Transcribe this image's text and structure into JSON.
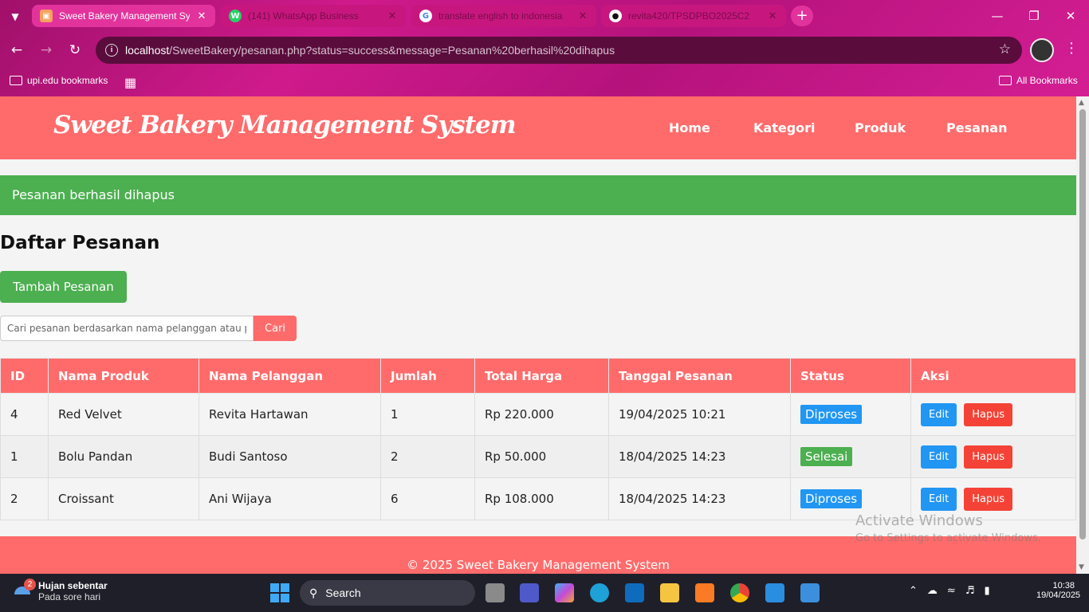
{
  "browser": {
    "tabs": [
      {
        "title": "Sweet Bakery Management Syst",
        "active": true
      },
      {
        "title": "(141) WhatsApp Business",
        "active": false
      },
      {
        "title": "translate english to indonesia",
        "active": false
      },
      {
        "title": "revita420/TPSDPBO2025C2",
        "active": false
      }
    ],
    "new_tab_label": "+",
    "url_host": "localhost",
    "url_path": "/SweetBakery/pesanan.php?status=success&message=Pesanan%20berhasil%20dihapus",
    "bookmarks": [
      {
        "label": "upi.edu bookmarks"
      },
      {
        "label": "All Bookmarks"
      }
    ]
  },
  "site": {
    "title": "Sweet Bakery Management System",
    "nav": [
      "Home",
      "Kategori",
      "Produk",
      "Pesanan"
    ],
    "alert": "Pesanan berhasil dihapus",
    "page_title": "Daftar Pesanan",
    "add_button": "Tambah Pesanan",
    "search": {
      "placeholder": "Cari pesanan berdasarkan nama pelanggan atau p",
      "button": "Cari"
    },
    "table": {
      "headers": [
        "ID",
        "Nama Produk",
        "Nama Pelanggan",
        "Jumlah",
        "Total Harga",
        "Tanggal Pesanan",
        "Status",
        "Aksi"
      ],
      "rows": [
        {
          "id": "4",
          "produk": "Red Velvet",
          "pelanggan": "Revita Hartawan",
          "jumlah": "1",
          "total": "Rp 220.000",
          "tanggal": "19/04/2025 10:21",
          "status": "Diproses",
          "status_color": "#2196f3"
        },
        {
          "id": "1",
          "produk": "Bolu Pandan",
          "pelanggan": "Budi Santoso",
          "jumlah": "2",
          "total": "Rp 50.000",
          "tanggal": "18/04/2025 14:23",
          "status": "Selesai",
          "status_color": "#4caf50"
        },
        {
          "id": "2",
          "produk": "Croissant",
          "pelanggan": "Ani Wijaya",
          "jumlah": "6",
          "total": "Rp 108.000",
          "tanggal": "18/04/2025 14:23",
          "status": "Diproses",
          "status_color": "#2196f3"
        }
      ],
      "edit_label": "Edit",
      "delete_label": "Hapus"
    },
    "footer": "© 2025 Sweet Bakery Management System",
    "accent_color": "#ff6b6b",
    "success_color": "#4caf50"
  },
  "os": {
    "watermark_line1": "Activate Windows",
    "watermark_line2": "Go to Settings to activate Windows.",
    "weather_title": "Hujan sebentar",
    "weather_sub": "Pada sore hari",
    "weather_badge": "2",
    "search_label": "Search",
    "time": "10:38",
    "date": "19/04/2025"
  }
}
